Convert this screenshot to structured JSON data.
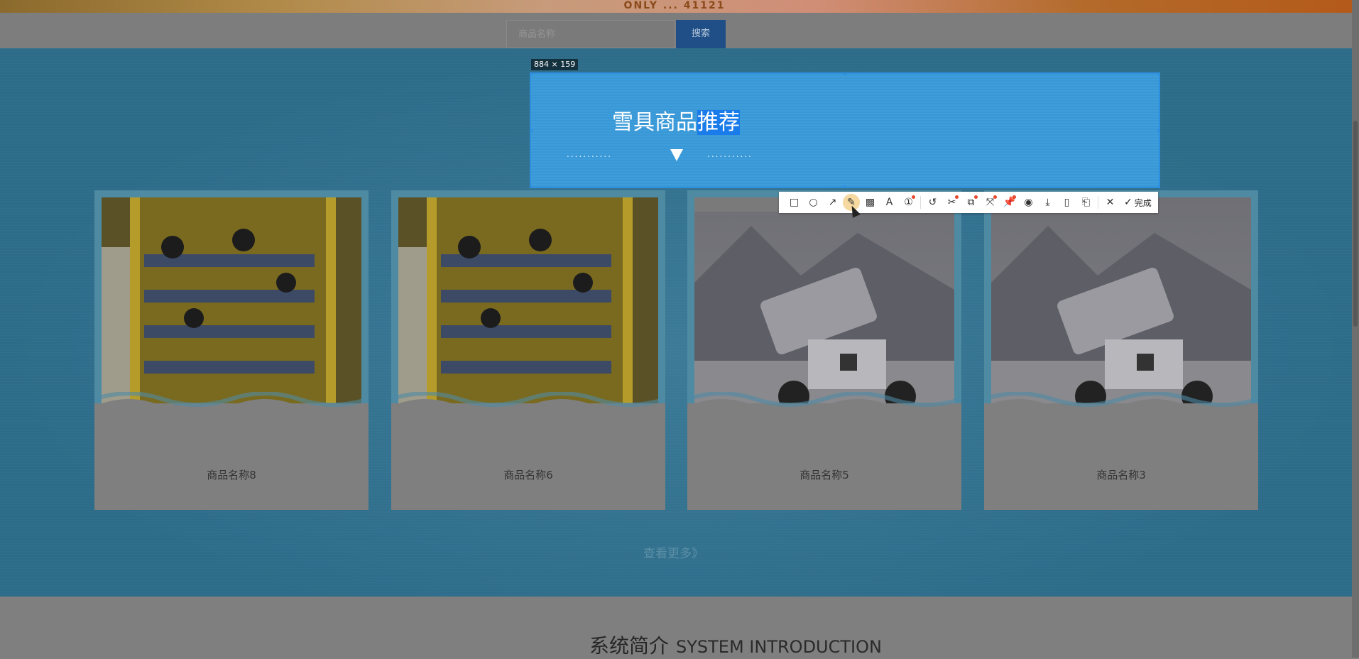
{
  "banner": {
    "ribbon_text": "ONLY ... 41121"
  },
  "search": {
    "placeholder": "商品名称",
    "button_label": "搜索"
  },
  "capture": {
    "size_label": "884 × 159"
  },
  "recommend": {
    "title_plain": "雪具商品",
    "title_highlight": "推荐",
    "dots_left": "...........",
    "dots_right": "..........."
  },
  "toolbar": {
    "items": [
      {
        "icon": "rectangle-icon",
        "glyph": "□"
      },
      {
        "icon": "ellipse-icon",
        "glyph": "○"
      },
      {
        "icon": "arrow-icon",
        "glyph": "↗"
      },
      {
        "icon": "pencil-icon",
        "glyph": "✎"
      },
      {
        "icon": "mosaic-icon",
        "glyph": "▩"
      },
      {
        "icon": "text-icon",
        "glyph": "A"
      },
      {
        "icon": "number-icon",
        "glyph": "①"
      },
      {
        "icon": "undo-icon",
        "glyph": "↺"
      },
      {
        "icon": "scissors-icon",
        "glyph": "✂"
      },
      {
        "icon": "ocr-icon",
        "glyph": "⧉"
      },
      {
        "icon": "translate-icon",
        "glyph": "⤧"
      },
      {
        "icon": "pin-icon",
        "glyph": "📌"
      },
      {
        "icon": "record-icon",
        "glyph": "◉"
      },
      {
        "icon": "download-icon",
        "glyph": "⤓"
      },
      {
        "icon": "mobile-icon",
        "glyph": "▯"
      },
      {
        "icon": "bookmark-icon",
        "glyph": "⎗"
      }
    ],
    "close_glyph": "✕",
    "done_label": "完成"
  },
  "products": [
    {
      "name": "商品名称8",
      "image": "snowboard-rack"
    },
    {
      "name": "商品名称6",
      "image": "snowboard-rack"
    },
    {
      "name": "商品名称5",
      "image": "snow-cannon"
    },
    {
      "name": "商品名称3",
      "image": "snow-cannon"
    }
  ],
  "more_link": "查看更多》",
  "intro": {
    "title_cn": "系统简介",
    "title_en": "SYSTEM INTRODUCTION"
  }
}
